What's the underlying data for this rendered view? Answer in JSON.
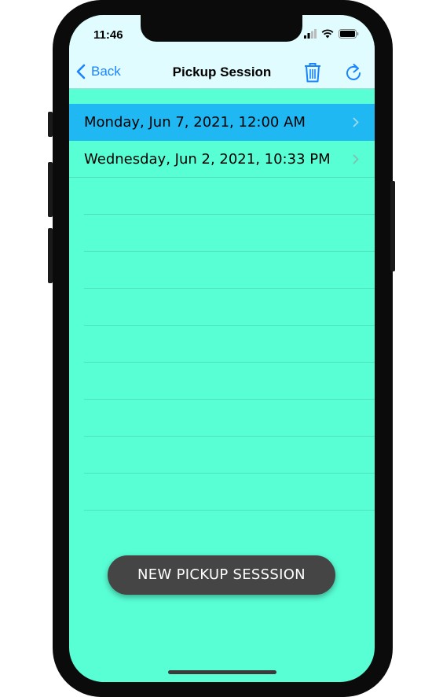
{
  "status_bar": {
    "time": "11:46"
  },
  "nav": {
    "back_label": "Back",
    "title": "Pickup Session",
    "icons": [
      "chevron-left-icon",
      "trash-icon",
      "refresh-icon"
    ]
  },
  "sessions": [
    {
      "label": "Monday, Jun 7, 2021, 12:00 AM",
      "selected": true
    },
    {
      "label": "Wednesday, Jun 2, 2021, 10:33 PM",
      "selected": false
    }
  ],
  "fab": {
    "label": "NEW PICKUP SESSSION"
  },
  "colors": {
    "background": "#58ffd5",
    "navbar": "#e0fcff",
    "accent": "#1a84ff",
    "selected_row": "#1fb8f2",
    "fab": "#454545"
  }
}
